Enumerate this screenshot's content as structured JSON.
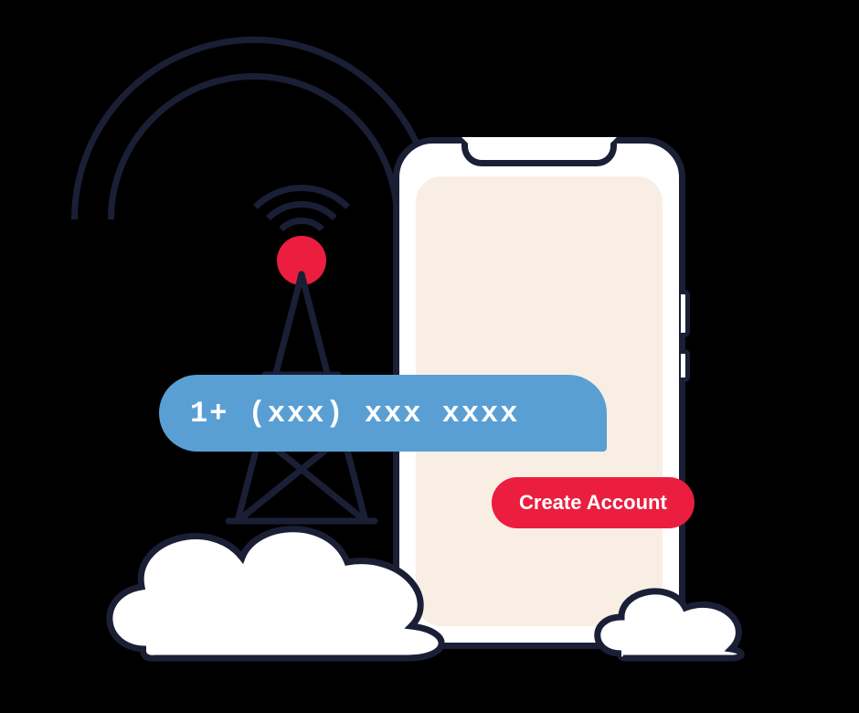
{
  "phone_bubble": {
    "text": "1+ (xxx) xxx xxxx"
  },
  "cta": {
    "label": "Create Account"
  },
  "colors": {
    "accent_red": "#eb1e3f",
    "bubble_blue": "#5a9fd4",
    "screen_bg": "#f8eee4",
    "stroke": "#1a1f36"
  }
}
